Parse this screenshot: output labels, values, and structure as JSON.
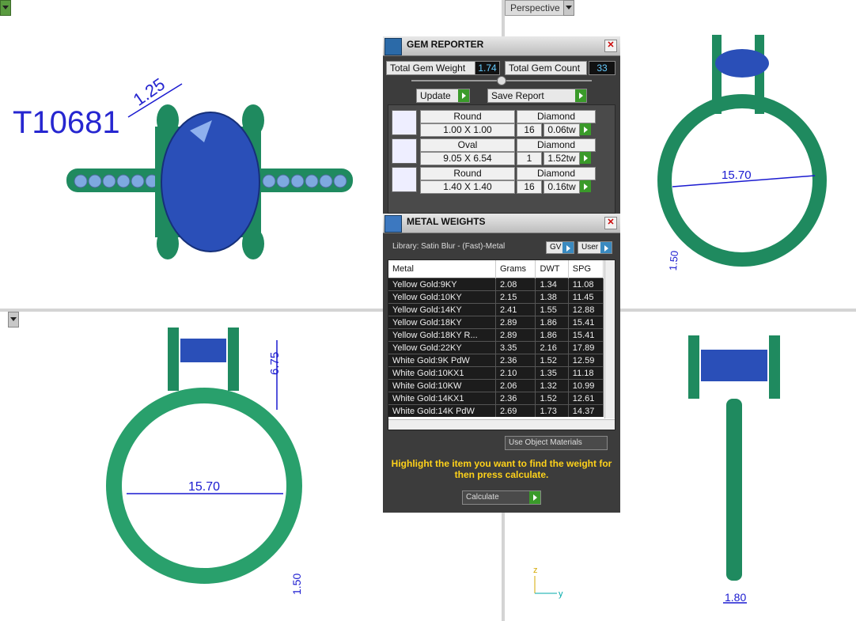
{
  "viewports": {
    "top_right_label": "Perspective"
  },
  "annotations": {
    "part_number": "T10681",
    "dim_prong": "1.25",
    "dim_height": "6.75",
    "dim_diameter": "15.70",
    "dim_band": "1.50",
    "dim_width": "1.80",
    "axis_z": "z",
    "axis_y": "y"
  },
  "gem_reporter": {
    "title": "GEM REPORTER",
    "total_weight_label": "Total Gem Weight",
    "total_weight_value": "1.74",
    "total_count_label": "Total Gem Count",
    "total_count_value": "33",
    "update_label": "Update",
    "save_label": "Save Report",
    "gems": [
      {
        "shape": "Round",
        "size": "1.00 X 1.00",
        "material": "Diamond",
        "count": "16",
        "weight": "0.06tw"
      },
      {
        "shape": "Oval",
        "size": "9.05 X 6.54",
        "material": "Diamond",
        "count": "1",
        "weight": "1.52tw"
      },
      {
        "shape": "Round",
        "size": "1.40 X 1.40",
        "material": "Diamond",
        "count": "16",
        "weight": "0.16tw"
      }
    ]
  },
  "metal_weights": {
    "title": "METAL WEIGHTS",
    "library": "Library: Satin Blur - (Fast)-Metal",
    "gv_label": "GV",
    "user_label": "User",
    "columns": [
      "Metal",
      "Grams",
      "DWT",
      "SPG"
    ],
    "rows": [
      [
        "Yellow Gold:9KY",
        "2.08",
        "1.34",
        "11.08"
      ],
      [
        "Yellow Gold:10KY",
        "2.15",
        "1.38",
        "11.45"
      ],
      [
        "Yellow Gold:14KY",
        "2.41",
        "1.55",
        "12.88"
      ],
      [
        "Yellow Gold:18KY",
        "2.89",
        "1.86",
        "15.41"
      ],
      [
        "Yellow Gold:18KY R...",
        "2.89",
        "1.86",
        "15.41"
      ],
      [
        "Yellow Gold:22KY",
        "3.35",
        "2.16",
        "17.89"
      ],
      [
        "White Gold:9K PdW",
        "2.36",
        "1.52",
        "12.59"
      ],
      [
        "White Gold:10KX1",
        "2.10",
        "1.35",
        "11.18"
      ],
      [
        "White Gold:10KW",
        "2.06",
        "1.32",
        "10.99"
      ],
      [
        "White Gold:14KX1",
        "2.36",
        "1.52",
        "12.61"
      ],
      [
        "White Gold:14K PdW",
        "2.69",
        "1.73",
        "14.37"
      ]
    ],
    "use_object_label": "Use Object Materials",
    "message": "Highlight the item you want to find the weight for then press calculate.",
    "calculate_label": "Calculate"
  },
  "colors": {
    "ring": "#1f8a5f",
    "gem": "#2a4fb8",
    "dimension": "#1a1ad0"
  }
}
